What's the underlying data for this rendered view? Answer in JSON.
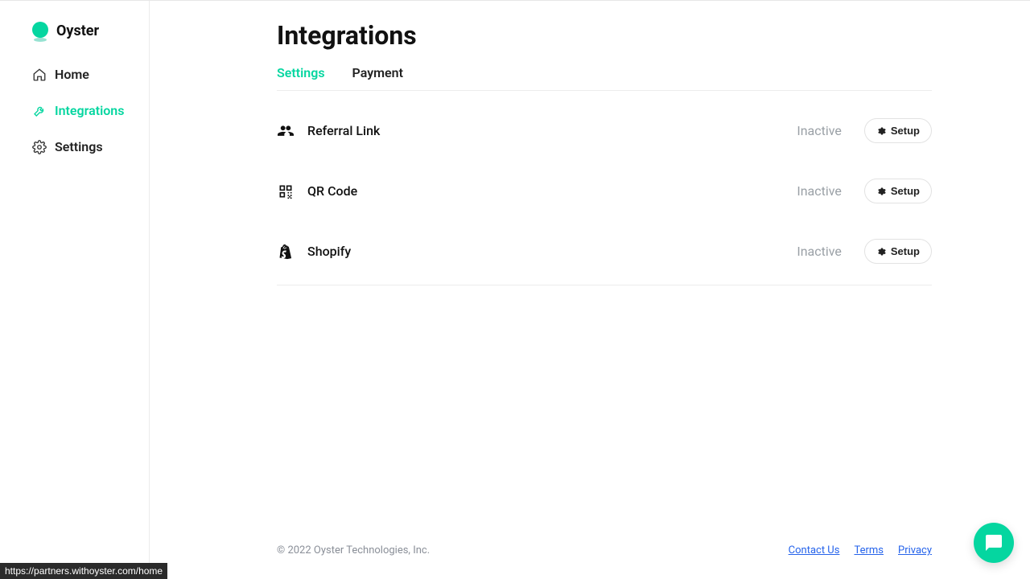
{
  "brand": {
    "name": "Oyster"
  },
  "sidebar": {
    "items": [
      {
        "label": "Home",
        "active": false
      },
      {
        "label": "Integrations",
        "active": true
      },
      {
        "label": "Settings",
        "active": false
      }
    ]
  },
  "page": {
    "title": "Integrations"
  },
  "tabs": [
    {
      "label": "Settings",
      "active": true
    },
    {
      "label": "Payment",
      "active": false
    }
  ],
  "integrations": [
    {
      "name": "Referral Link",
      "status": "Inactive",
      "action": "Setup"
    },
    {
      "name": "QR Code",
      "status": "Inactive",
      "action": "Setup"
    },
    {
      "name": "Shopify",
      "status": "Inactive",
      "action": "Setup"
    }
  ],
  "footer": {
    "copyright": "© 2022 Oyster Technologies, Inc.",
    "links": [
      {
        "label": "Contact Us"
      },
      {
        "label": "Terms"
      },
      {
        "label": "Privacy"
      }
    ]
  },
  "url_preview": "https://partners.withoyster.com/home"
}
